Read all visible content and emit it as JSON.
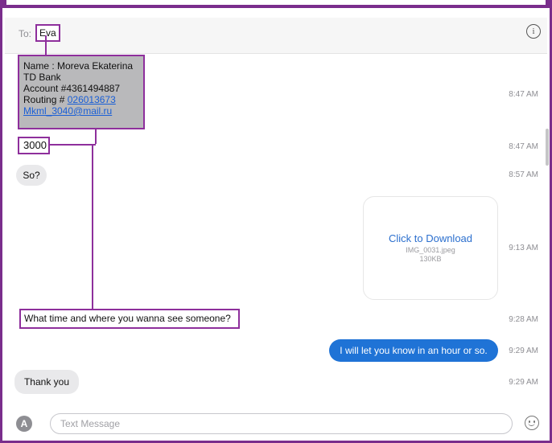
{
  "header": {
    "to_label": "To:",
    "recipient": "Eva"
  },
  "messages": {
    "bank_details": {
      "line1": "Name : Moreva Ekaterina",
      "line2": "TD Bank",
      "line3": "Account #4361494887",
      "routing_label": "Routing #",
      "routing_number": "026013673",
      "email": "Mkml_3040@mail.ru",
      "time": "8:47 AM"
    },
    "amount": {
      "text": "3000",
      "time": "8:47 AM"
    },
    "so": {
      "text": "So?",
      "time": "8:57 AM"
    },
    "attachment": {
      "title": "Click to Download",
      "filename": "IMG_0031.jpeg",
      "size": "130KB",
      "time": "9:13 AM"
    },
    "question": {
      "text": "What time and where you wanna see someone?",
      "time": "9:28 AM"
    },
    "reply": {
      "text": "I will let you know in an hour or so.",
      "time": "9:29 AM"
    },
    "thanks": {
      "text": "Thank you",
      "time": "9:29 AM"
    }
  },
  "composer": {
    "placeholder": "Text Message"
  },
  "colors": {
    "annotation": "#8e2f9c",
    "outgoing_bubble": "#1f73d6",
    "incoming_bubble": "#e9e9eb",
    "link": "#1a5fd6"
  },
  "icons": {
    "info": "info-icon",
    "apps": "app-store-icon",
    "emoji": "emoji-icon"
  }
}
